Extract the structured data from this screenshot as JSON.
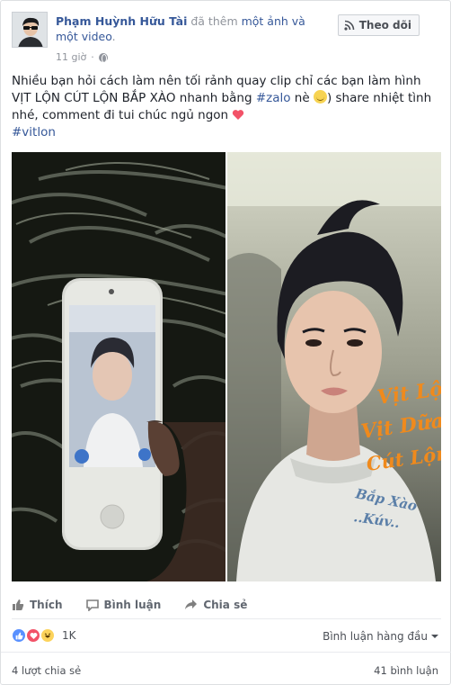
{
  "header": {
    "author": "Phạm Huỳnh Hữu Tài",
    "action_prefix": " đã thêm ",
    "action_link": "một ảnh và một video",
    "action_suffix": ".",
    "time": "11 giờ",
    "privacy_icon": "globe-icon",
    "follow_label": "Theo dõi",
    "follow_icon": "rss-icon"
  },
  "post": {
    "text_part1": "Nhiều bạn hỏi cách làm nên tối rảnh quay clip chỉ các bạn làm hình VỊT LỘN CÚT LỘN BẮP XÀO nhanh bằng ",
    "hashtag1": "#zalo",
    "text_part2": " nè ",
    "text_part3": ") share nhiệt tình nhé, comment đi tui chúc ngủ ngon ",
    "hashtag2": "#vitlon"
  },
  "photos": {
    "overlay_lines": [
      "Vịt Lộn",
      "Vịt Dữa",
      "Cút Lộn",
      "Bắp Xào",
      "..Kúv.."
    ]
  },
  "actions": {
    "like": "Thích",
    "comment": "Bình luận",
    "share": "Chia sẻ"
  },
  "reactions": {
    "count": "1K",
    "sort_label": "Bình luận hàng đầu"
  },
  "footer": {
    "shares": "4 lượt chia sẻ",
    "comments": "41 bình luận"
  },
  "colors": {
    "link": "#365899",
    "muted": "#90949c",
    "heart": "#f25268",
    "overlay_text": "#f08a1c"
  }
}
